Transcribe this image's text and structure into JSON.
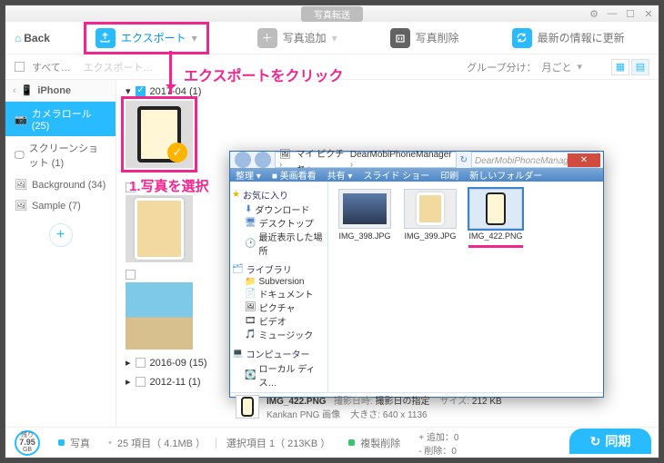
{
  "titlebar": {
    "title": "写真転送"
  },
  "toolbar": {
    "back": "Back",
    "export": "エクスポート",
    "add": "写真追加",
    "delete": "写真削除",
    "refresh": "最新の情報に更新"
  },
  "subbar": {
    "select_all": "すべて…",
    "group_label": "グループ分け：",
    "group_value": "月ごと"
  },
  "sidebar": {
    "device": "iPhone",
    "items": [
      {
        "label": "カメラロール (25)"
      },
      {
        "label": "スクリーンショット (1)"
      },
      {
        "label": "Background (34)"
      },
      {
        "label": "Sample (7)"
      }
    ]
  },
  "groups": [
    {
      "title": "2017-04 (1)",
      "checked": true
    },
    {
      "title": "2016-09 (15)",
      "checked": false
    },
    {
      "title": "2012-11 (1)",
      "checked": false
    }
  ],
  "annotations": {
    "click_export": "エクスポートをクリック",
    "select_photo": "1.写真を選択"
  },
  "status": {
    "disk_label": "残り",
    "disk_value": "7.95",
    "disk_unit": "GB",
    "photos": "写真",
    "counts": "25 項目（ 4.1MB ）",
    "selected": "選択項目 1（ 213KB ）",
    "dup": "複製削除",
    "add_stat": "+ 追加：0",
    "del_stat": "- 削除：0",
    "sync": "同期"
  },
  "explorer": {
    "breadcrumb": [
      "マイ ピクチャ",
      "DearMobiPhoneManager"
    ],
    "search_placeholder": "DearMobiPhoneManagerの検索",
    "menu": [
      "整理 ▾",
      "■ 美画看看",
      "共有 ▾",
      "スライド ショー",
      "印刷",
      "新しいフォルダー"
    ],
    "tree": {
      "fav": "お気に入り",
      "fav_items": [
        "ダウンロード",
        "デスクトップ",
        "最近表示した場所"
      ],
      "lib": "ライブラリ",
      "lib_items": [
        "Subversion",
        "ドキュメント",
        "ピクチャ",
        "ビデオ",
        "ミュージック"
      ],
      "pc": "コンピューター",
      "pc_items": [
        "ローカル ディス…"
      ]
    },
    "files": [
      "IMG_398.JPG",
      "IMG_399.JPG",
      "IMG_422.PNG"
    ],
    "detail": {
      "name": "IMG_422.PNG",
      "type": "Kankan PNG 画像",
      "date_lbl": "撮影日時:",
      "date_val": "撮影日の指定",
      "dim_lbl": "大きさ:",
      "dim_val": "640 x 1136",
      "size_lbl": "サイズ:",
      "size_val": "212 KB"
    }
  },
  "export_tip": "エクスポート…"
}
